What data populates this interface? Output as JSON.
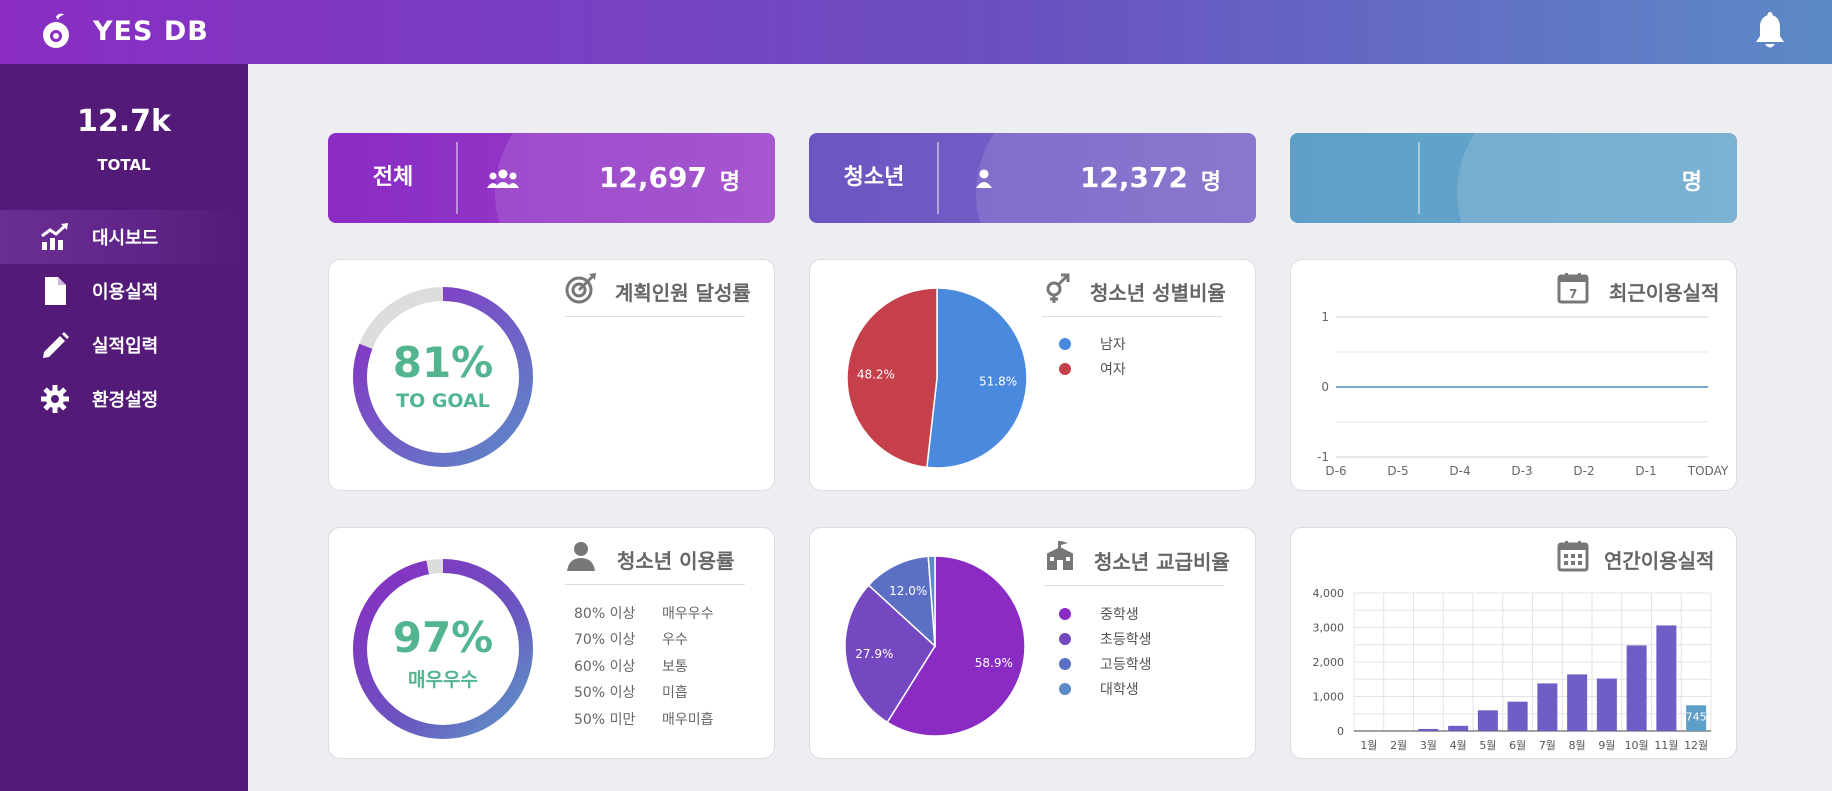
{
  "header": {
    "brand": "YES DB",
    "logo_icon": "pomegranate-logo-icon",
    "bell_icon": "bell-icon"
  },
  "sidebar": {
    "total_value": "12.7k",
    "total_label": "TOTAL",
    "items": [
      {
        "label": "대시보드",
        "icon": "chart-line-icon",
        "active": true
      },
      {
        "label": "이용실적",
        "icon": "document-icon",
        "active": false
      },
      {
        "label": "실적입력",
        "icon": "pencil-icon",
        "active": false
      },
      {
        "label": "환경설정",
        "icon": "gear-icon",
        "active": false
      }
    ]
  },
  "stats": [
    {
      "label": "전체",
      "icon": "users-icon",
      "value": "12,697",
      "unit": "명",
      "color": "#8a2cc4"
    },
    {
      "label": "청소년",
      "icon": "user-icon",
      "value": "12,372",
      "unit": "명",
      "color": "#6c55c2"
    },
    {
      "label": "",
      "icon": "",
      "value": "",
      "unit": "명",
      "color": "#5d9fc7"
    }
  ],
  "goal_card": {
    "title": "계획인원 달성률",
    "icon": "target-icon",
    "percent_text": "81%",
    "sub_text": "TO GOAL",
    "progress": 0.81
  },
  "gender_card": {
    "title": "청소년 성별비율",
    "icon": "gender-icon",
    "legend": [
      {
        "label": "남자",
        "color": "#4a8ade"
      },
      {
        "label": "여자",
        "color": "#c5404a"
      }
    ]
  },
  "recent_card": {
    "title": "최근이용실적",
    "icon": "calendar-7-icon"
  },
  "usage_card": {
    "title": "청소년 이용률",
    "icon": "person-icon",
    "percent_text": "97%",
    "sub_text": "매우우수",
    "progress": 0.97,
    "grades": [
      {
        "range": "80% 이상",
        "name": "매우우수"
      },
      {
        "range": "70% 이상",
        "name": "우수"
      },
      {
        "range": "60% 이상",
        "name": "보통"
      },
      {
        "range": "50% 이상",
        "name": "미흡"
      },
      {
        "range": "50% 미만",
        "name": "매우미흡"
      }
    ]
  },
  "school_card": {
    "title": "청소년 교급비율",
    "icon": "school-icon",
    "legend": [
      {
        "label": "중학생",
        "color": "#8a2cc4"
      },
      {
        "label": "초등학생",
        "color": "#7548c2"
      },
      {
        "label": "고등학생",
        "color": "#5b70c4"
      },
      {
        "label": "대학생",
        "color": "#5b8ac8"
      }
    ]
  },
  "annual_card": {
    "title": "연간이용실적",
    "icon": "calendar-grid-icon"
  },
  "chart_data": [
    {
      "type": "pie",
      "labels": [
        "남자",
        "여자"
      ],
      "values": [
        51.8,
        48.2
      ],
      "data_labels": [
        "51.8%",
        "48.2%"
      ],
      "colors": [
        "#4a8ade",
        "#c5404a"
      ]
    },
    {
      "type": "line",
      "categories": [
        "D-6",
        "D-5",
        "D-4",
        "D-3",
        "D-2",
        "D-1",
        "TODAY"
      ],
      "values": [
        0,
        0,
        0,
        0,
        0,
        0,
        0
      ],
      "ylim": [
        -1,
        1
      ],
      "yticks": [
        "1",
        "0",
        "-1"
      ],
      "grid": true,
      "color": "#4a8ab8"
    },
    {
      "type": "pie",
      "labels": [
        "중학생",
        "초등학생",
        "고등학생",
        "대학생"
      ],
      "values": [
        58.9,
        27.9,
        12.0,
        1.2
      ],
      "data_labels": [
        "58.9%",
        "27.9%",
        "12.0%",
        ""
      ],
      "colors": [
        "#8a2cc4",
        "#7548c2",
        "#5b70c4",
        "#5b8ac8"
      ]
    },
    {
      "type": "bar",
      "categories": [
        "1월",
        "2월",
        "3월",
        "4월",
        "5월",
        "6월",
        "7월",
        "8월",
        "9월",
        "10월",
        "11월",
        "12월"
      ],
      "values": [
        0,
        0,
        60,
        150,
        600,
        850,
        1380,
        1640,
        1520,
        2480,
        3060,
        745
      ],
      "data_labels": [
        "",
        "",
        "",
        "",
        "",
        "",
        "",
        "",
        "",
        "",
        "",
        "745"
      ],
      "ylim": [
        0,
        4000
      ],
      "yticks": [
        "0",
        "1,000",
        "2,000",
        "3,000",
        "4,000"
      ],
      "grid": true,
      "color": "#6e5ec6",
      "highlight_color": "#5d9fc7"
    }
  ]
}
